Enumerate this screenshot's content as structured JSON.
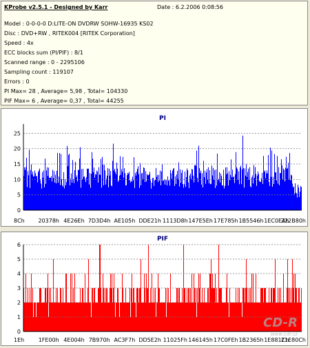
{
  "header": {
    "title": "KProbe v2.5.1 - Designed by Karr",
    "date": "Date : 6.2.2006 0:08:56"
  },
  "info_lines": [
    "Model : 0-0-0-0 D:LITE-ON DVDRW SOHW-16935 KS02",
    "Disc : DVD+RW , RITEK004 [RITEK Corporation]",
    "Speed : 4x",
    "ECC blocks sum (PI/PIF) : 8/1",
    "Scanned range : 0 - 2295106",
    "Sampling count : 119107",
    "Errors : 0",
    "PI Max= 28 , Average= 5,98 , Total= 104330",
    "PIF Max= 6 , Average= 0,37 , Total= 44255"
  ],
  "watermark": {
    "logo": "CD-R",
    "url": "www.cdr.cz"
  },
  "chart_data": [
    {
      "type": "bar",
      "title": "PI",
      "color": "#0000ff",
      "ylim": [
        0,
        28
      ],
      "yticks": [
        0,
        5,
        10,
        15,
        20,
        25
      ],
      "grid": true,
      "x_tick_labels": [
        "8Ch",
        "20378h",
        "4E26Eh",
        "7D3D4h",
        "AE105h",
        "DDE21h",
        "1113D8h",
        "147E5Eh",
        "17E785h",
        "1B5546h",
        "1EC0E4h",
        "222B80h"
      ],
      "summary": {
        "max": 28,
        "average": 5.98,
        "total": 104330
      }
    },
    {
      "type": "bar",
      "title": "PIF",
      "color": "#ff0000",
      "ylim": [
        0,
        6
      ],
      "yticks": [
        0,
        1,
        2,
        3,
        4,
        5,
        6
      ],
      "grid": true,
      "x_tick_labels": [
        "1Eh",
        "1FE00h",
        "4E004h",
        "7B970h",
        "AC3F7h",
        "DD5E2h",
        "11025Fh",
        "146145h",
        "17C0FEh",
        "1B2365h",
        "1E881Ch",
        "21E80Ch"
      ],
      "summary": {
        "max": 6,
        "average": 0.37,
        "total": 44255
      }
    }
  ]
}
